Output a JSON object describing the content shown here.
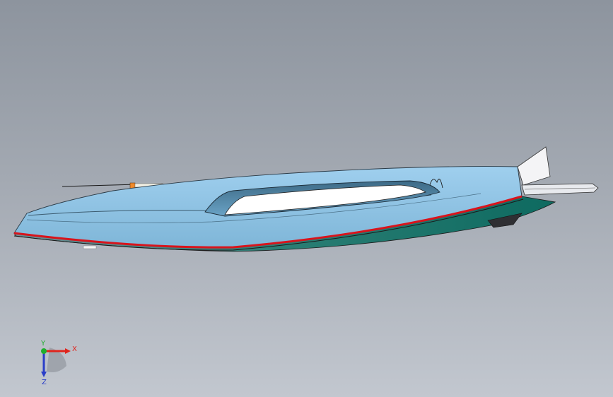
{
  "viewport": {
    "background_top": "#8d949e",
    "background_bottom": "#c2c7cf"
  },
  "model": {
    "deck_color": "#8cc2e2",
    "hull_color": "#1f7a6e",
    "stripe_color": "#d8141c",
    "cockpit_color": "#ffffff"
  },
  "triad": {
    "x_label": "X",
    "y_label": "Y",
    "z_label": "Z",
    "x_color": "#e0241c",
    "y_color": "#1fae2e",
    "z_color": "#2a3ec8"
  }
}
